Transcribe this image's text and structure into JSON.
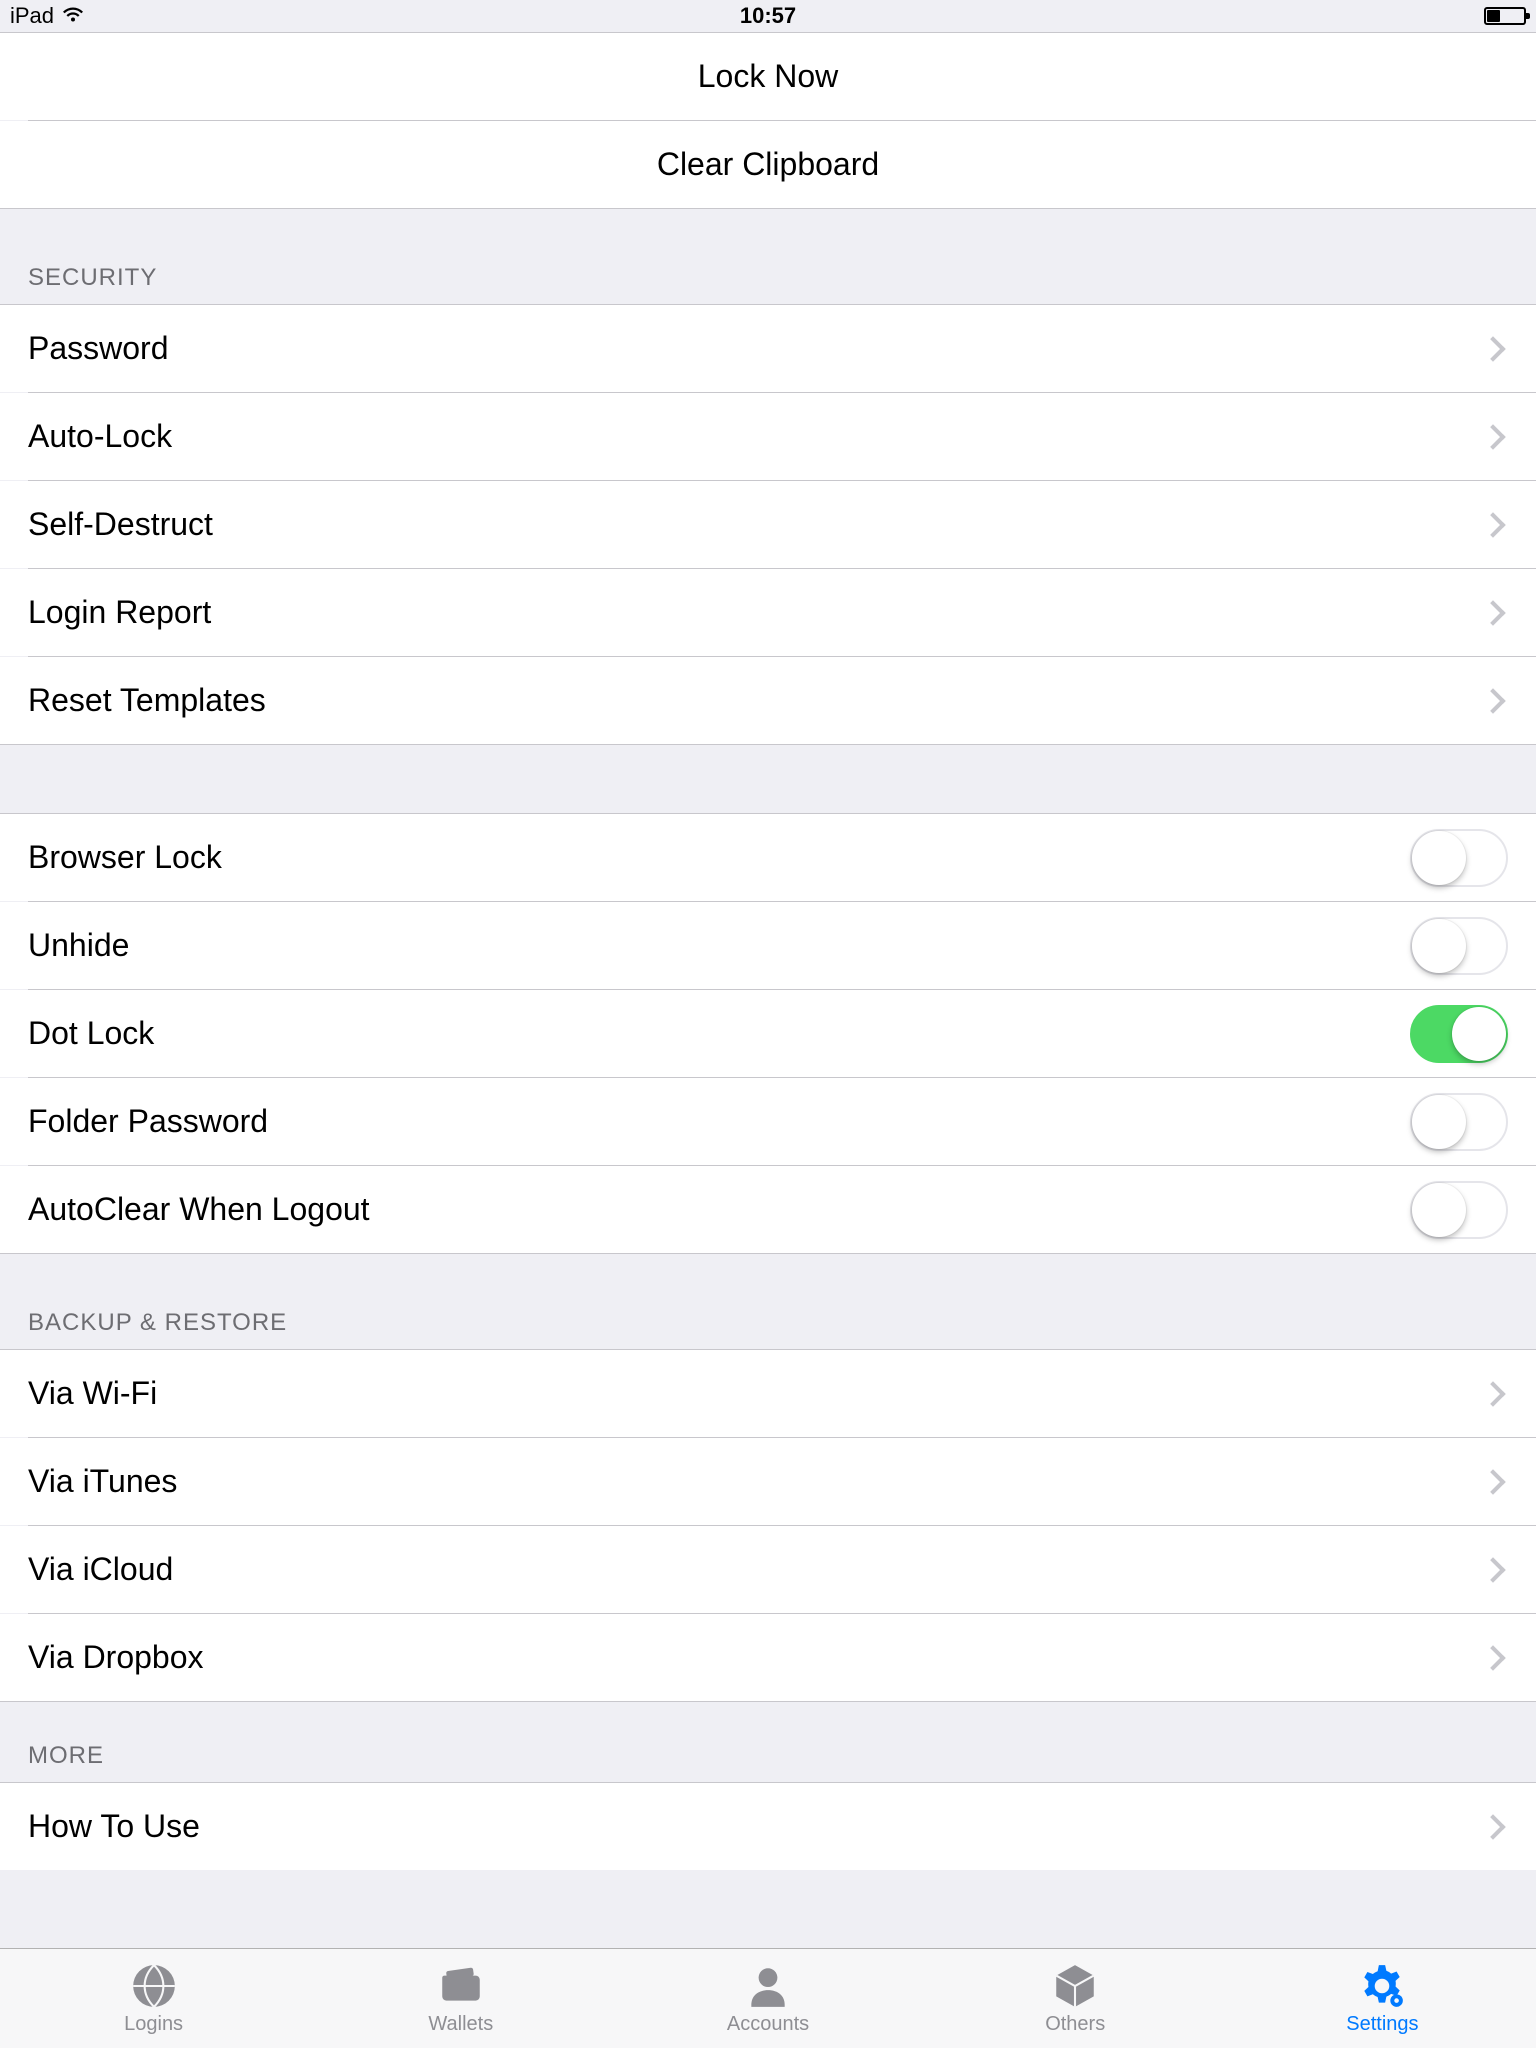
{
  "status": {
    "device": "iPad",
    "time": "10:57"
  },
  "topActions": {
    "lock": "Lock Now",
    "clear": "Clear Clipboard"
  },
  "sections": {
    "security": {
      "header": "SECURITY",
      "password": "Password",
      "autolock": "Auto-Lock",
      "selfdestruct": "Self-Destruct",
      "loginreport": "Login Report",
      "resettemplates": "Reset Templates"
    },
    "toggles": {
      "browserlock": {
        "label": "Browser Lock",
        "on": false
      },
      "unhide": {
        "label": "Unhide",
        "on": false
      },
      "dotlock": {
        "label": "Dot Lock",
        "on": true
      },
      "folderpassword": {
        "label": "Folder Password",
        "on": false
      },
      "autoclear": {
        "label": "AutoClear When Logout",
        "on": false
      }
    },
    "backup": {
      "header": "BACKUP & RESTORE",
      "wifi": "Via Wi-Fi",
      "itunes": "Via iTunes",
      "icloud": "Via iCloud",
      "dropbox": "Via Dropbox"
    },
    "more": {
      "header": "MORE",
      "howto": "How To Use"
    }
  },
  "tabs": {
    "logins": "Logins",
    "wallets": "Wallets",
    "accounts": "Accounts",
    "others": "Others",
    "settings": "Settings"
  },
  "colors": {
    "accent": "#007aff",
    "toggleOn": "#4cd964"
  }
}
